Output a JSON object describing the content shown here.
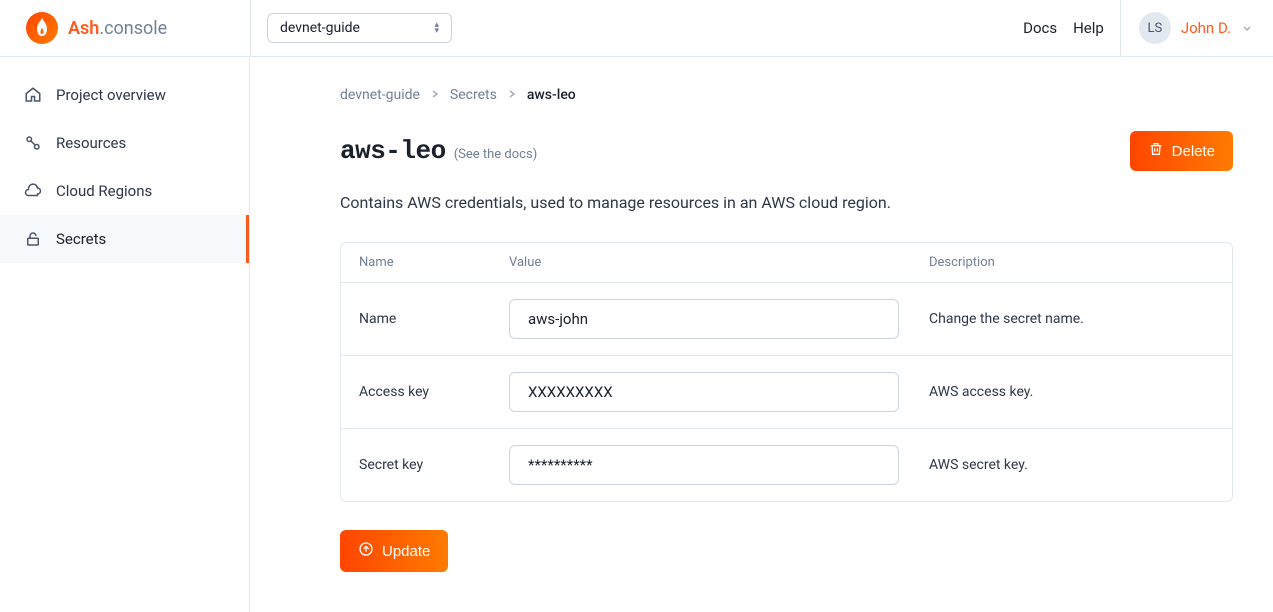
{
  "brand": {
    "ash": "Ash",
    "console": ".console"
  },
  "header": {
    "project": "devnet-guide",
    "docs": "Docs",
    "help": "Help",
    "avatar_initials": "LS",
    "username": "John D."
  },
  "sidebar": {
    "items": [
      {
        "label": "Project overview"
      },
      {
        "label": "Resources"
      },
      {
        "label": "Cloud Regions"
      },
      {
        "label": "Secrets"
      }
    ]
  },
  "breadcrumb": {
    "items": [
      "devnet-guide",
      "Secrets",
      "aws-leo"
    ]
  },
  "page": {
    "title": "aws-leo",
    "docs_hint": "(See the docs)",
    "delete_label": "Delete",
    "description": "Contains AWS credentials, used to manage resources in an AWS cloud region.",
    "update_label": "Update"
  },
  "table": {
    "headers": {
      "name": "Name",
      "value": "Value",
      "description": "Description"
    },
    "rows": [
      {
        "name": "Name",
        "value": "aws-john",
        "desc": "Change the secret name."
      },
      {
        "name": "Access key",
        "value": "XXXXXXXXX",
        "desc": "AWS access key."
      },
      {
        "name": "Secret key",
        "value": "**********",
        "desc": "AWS secret key."
      }
    ]
  }
}
